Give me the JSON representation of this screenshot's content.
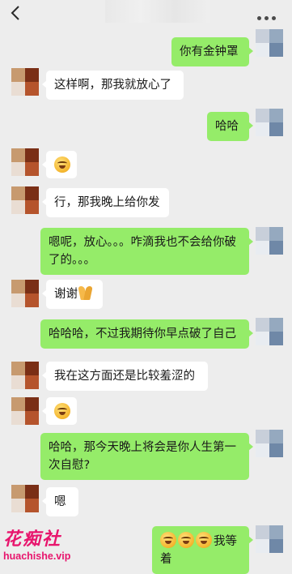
{
  "header": {
    "back_icon": "chevron-left-icon",
    "more_icon": "ellipsis-icon"
  },
  "messages": [
    {
      "side": "right",
      "text": "你有金钟罩"
    },
    {
      "side": "left",
      "text": "这样啊，那我就放心了"
    },
    {
      "side": "right",
      "text": "哈哈"
    },
    {
      "side": "left",
      "emoji": "grimace-emoji"
    },
    {
      "side": "left",
      "text": "行，那我晚上给你发"
    },
    {
      "side": "right",
      "text": "嗯呢，放心。。。咋滴我也不会给你破了的。。。"
    },
    {
      "side": "left",
      "text": "谢谢",
      "emoji": "folded-hands-emoji"
    },
    {
      "side": "right",
      "text": "哈哈哈，不过我期待你早点破了自己"
    },
    {
      "side": "left",
      "text": "我在这方面还是比较羞涩的"
    },
    {
      "side": "left",
      "emoji": "grimace-emoji"
    },
    {
      "side": "right",
      "text": "哈哈，那今天晚上将会是你人生第一次自慰?"
    },
    {
      "side": "left",
      "text": "嗯"
    },
    {
      "side": "right",
      "text": "我等着",
      "emoji": "grimace-emoji x3"
    }
  ],
  "watermark": {
    "name": "花痴社",
    "url": "huachishe.vip"
  },
  "colors": {
    "background": "#ededed",
    "bubble_sent": "#95ec69",
    "bubble_received": "#ffffff",
    "watermark": "#e8156d"
  }
}
